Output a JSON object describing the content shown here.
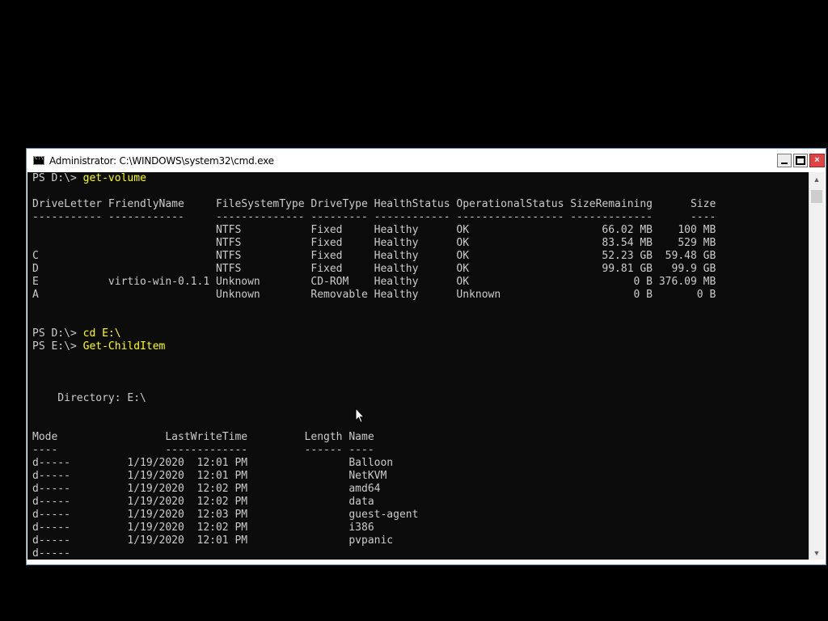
{
  "window": {
    "title": "Administrator: C:\\WINDOWS\\system32\\cmd.exe",
    "icon": "cmd-icon",
    "controls": {
      "minimize": "minimize-icon",
      "maximize": "maximize-icon",
      "close": "×"
    }
  },
  "console": {
    "lines": [
      {
        "prompt": "PS D:\\> ",
        "command": "get-volume"
      },
      {
        "text": ""
      },
      {
        "text": "DriveLetter FriendlyName     FileSystemType DriveType HealthStatus OperationalStatus SizeRemaining      Size"
      },
      {
        "text": "----------- ------------     -------------- --------- ------------ ----------------- -------------      ----"
      },
      {
        "text": "                             NTFS           Fixed     Healthy      OK                     66.02 MB    100 MB"
      },
      {
        "text": "                             NTFS           Fixed     Healthy      OK                     83.54 MB    529 MB"
      },
      {
        "text": "C                            NTFS           Fixed     Healthy      OK                     52.23 GB  59.48 GB"
      },
      {
        "text": "D                            NTFS           Fixed     Healthy      OK                     99.81 GB   99.9 GB"
      },
      {
        "text": "E           virtio-win-0.1.1 Unknown        CD-ROM    Healthy      OK                          0 B 376.09 MB"
      },
      {
        "text": "A                            Unknown        Removable Healthy      Unknown                     0 B       0 B"
      },
      {
        "text": ""
      },
      {
        "text": ""
      },
      {
        "prompt": "PS D:\\> ",
        "command": "cd E:\\"
      },
      {
        "prompt": "PS E:\\> ",
        "command": "Get-ChildItem"
      },
      {
        "text": ""
      },
      {
        "text": ""
      },
      {
        "text": ""
      },
      {
        "text": "    Directory: E:\\"
      },
      {
        "text": ""
      },
      {
        "text": ""
      },
      {
        "text": "Mode                 LastWriteTime         Length Name"
      },
      {
        "text": "----                 -------------         ------ ----"
      },
      {
        "text": "d-----         1/19/2020  12:01 PM                Balloon"
      },
      {
        "text": "d-----         1/19/2020  12:01 PM                NetKVM"
      },
      {
        "text": "d-----         1/19/2020  12:02 PM                amd64"
      },
      {
        "text": "d-----         1/19/2020  12:02 PM                data"
      },
      {
        "text": "d-----         1/19/2020  12:03 PM                guest-agent"
      },
      {
        "text": "d-----         1/19/2020  12:02 PM                i386"
      },
      {
        "text": "d-----         1/19/2020  12:01 PM                pvpanic"
      },
      {
        "text": "d-----"
      }
    ]
  },
  "scrollbar": {
    "up": "▲",
    "down": "▼"
  },
  "colors": {
    "console_bg": "#0c0c0c",
    "console_text": "#cccccc",
    "command_text": "#ffff00",
    "page_bg": "#000000"
  }
}
